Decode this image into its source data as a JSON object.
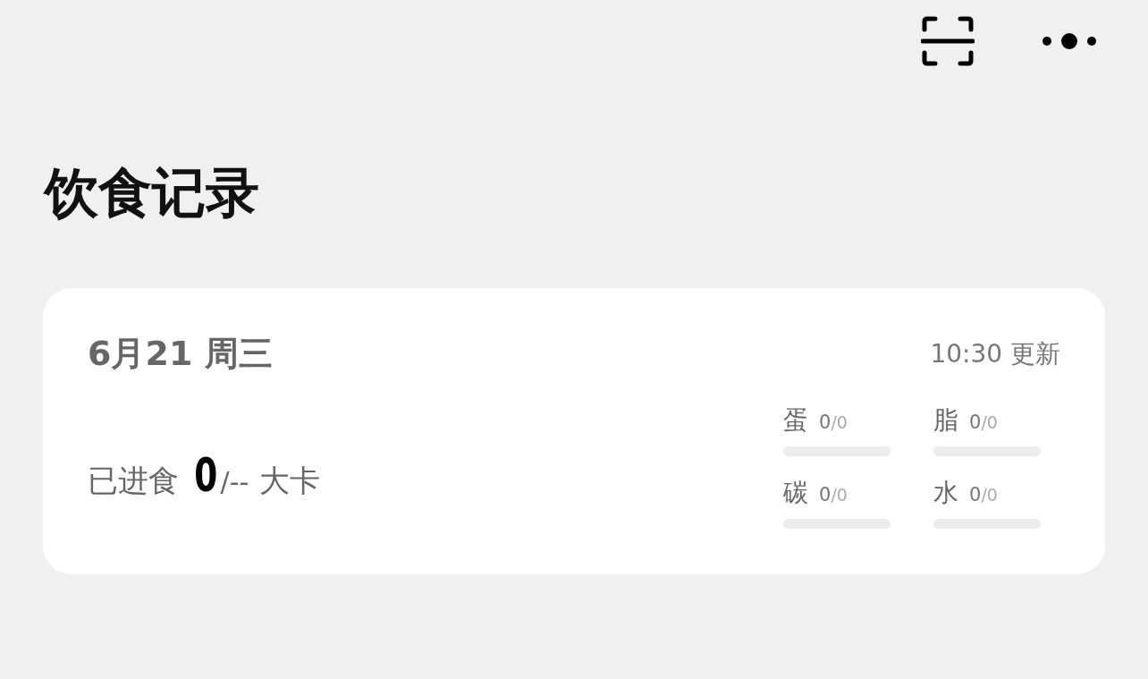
{
  "top_bar": {
    "actions": [
      {
        "kind": "scan"
      },
      {
        "kind": "more"
      }
    ]
  },
  "title": "饮食记录",
  "card": {
    "date": "6月21 周三",
    "updated": "10:30 更新",
    "intake": {
      "label": "已进食",
      "value": "0",
      "target": "/--",
      "unit": "大卡"
    },
    "macros": [
      {
        "name": "蛋",
        "value": "0",
        "target": "/0",
        "level": 0
      },
      {
        "name": "脂",
        "value": "0",
        "target": "/0",
        "level": 0
      },
      {
        "name": "碳",
        "value": "0",
        "target": "/0",
        "level": 0
      },
      {
        "name": "水",
        "value": "0",
        "target": "/0",
        "level": 0
      }
    ]
  }
}
